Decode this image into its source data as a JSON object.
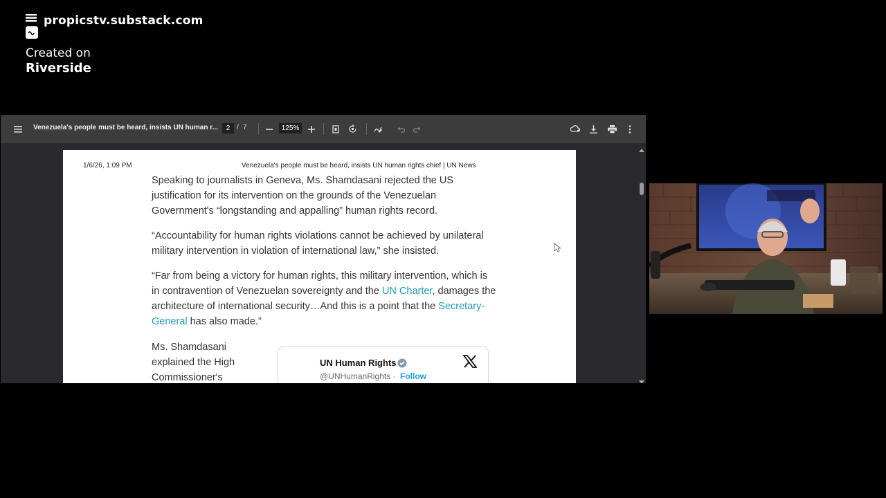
{
  "branding": {
    "url": "propicstv.substack.com",
    "created_on": "Created on",
    "platform": "Riverside"
  },
  "pdf_viewer": {
    "title": "Venezuela's people must be heard, insists UN human r...",
    "current_page": "2",
    "page_separator": "/",
    "total_pages": "7",
    "zoom": "125%",
    "icons": [
      "menu-icon",
      "zoom-out-icon",
      "zoom-in-icon",
      "fit-page-icon",
      "rotate-icon",
      "annotate-icon",
      "undo-icon",
      "redo-icon",
      "add-drive-icon",
      "download-icon",
      "print-icon",
      "more-icon"
    ]
  },
  "document": {
    "header_date": "1/6/26, 1:09 PM",
    "header_title": "Venezuela's people must be heard, insists UN human rights chief | UN News",
    "para1": "Speaking to journalists in Geneva, Ms. Shamdasani rejected the US justification for its intervention on the grounds of the Venezuelan Government's “longstanding and appalling” human rights record.",
    "para2": "“Accountability for human rights violations cannot be achieved by unilateral military intervention in violation of international law,” she insisted.",
    "para3_a": "“Far from being a victory for human rights, this military intervention, which is in contravention of Venezuelan sovereignty and the ",
    "para3_link1": "UN Charter",
    "para3_b": ", damages the architecture of international security…And this is a point that the ",
    "para3_link2": "Secretary-General",
    "para3_c": " has also made.”",
    "side_para": "Ms. Shamdasani explained the High Commissioner's",
    "tweet": {
      "name": "UN Human Rights",
      "handle": "@UNHumanRights",
      "separator": " · ",
      "follow": "Follow"
    }
  },
  "colors": {
    "toolbar": "#3c3c3c",
    "viewer_bg": "#2a2a2e",
    "link": "#1d9bb8",
    "follow": "#1d9bf0"
  }
}
